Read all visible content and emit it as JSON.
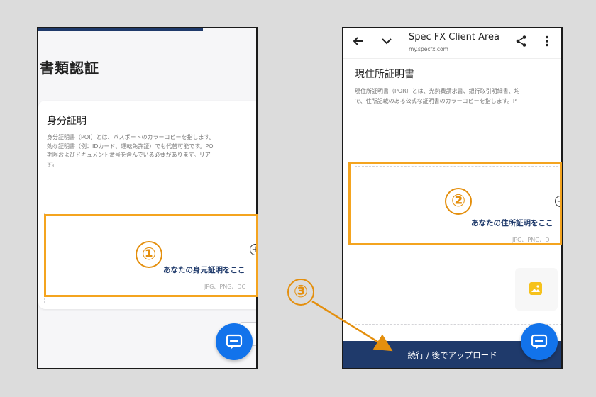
{
  "left_screen": {
    "heading": "書類認証",
    "card": {
      "title": "身分証明",
      "description": "身分証明書（POI）とは、パスポートのカラーコピーを指します。\n効な証明書（例：IDカード、運転免許証）でも代替可能です。PO\n期限およびドキュメント番号を含んでいる必要があります。リア\nす。",
      "upload_text": "あなたの身元証明をここ",
      "formats": "JPG、PNG、DC"
    },
    "step_badge": "①"
  },
  "right_screen": {
    "app_bar": {
      "title": "Spec FX Client Area",
      "url": "my.specfx.com"
    },
    "section": {
      "title": "現住所証明書",
      "description": "現住所証明書（POR）とは、光熱費請求書、銀行取引明細書、均\nで、住所記載のある公式な証明書のカラーコピーを指します。P",
      "upload_text": "あなたの住所証明をここ",
      "formats": "JPG、PNG、D"
    },
    "continue_button": "続行 / 後でアップロード",
    "step_badge_2": "②",
    "step_badge_3": "③"
  },
  "colors": {
    "highlight": "#f4a41f",
    "brand_navy": "#1f3a6b",
    "chat_blue": "#1273eb"
  },
  "icons": {
    "back": "back-arrow-icon",
    "dropdown": "chevron-down-icon",
    "share": "share-icon",
    "more": "more-vert-icon",
    "chat": "chat-icon",
    "add": "plus-circle-icon",
    "image": "image-icon"
  }
}
